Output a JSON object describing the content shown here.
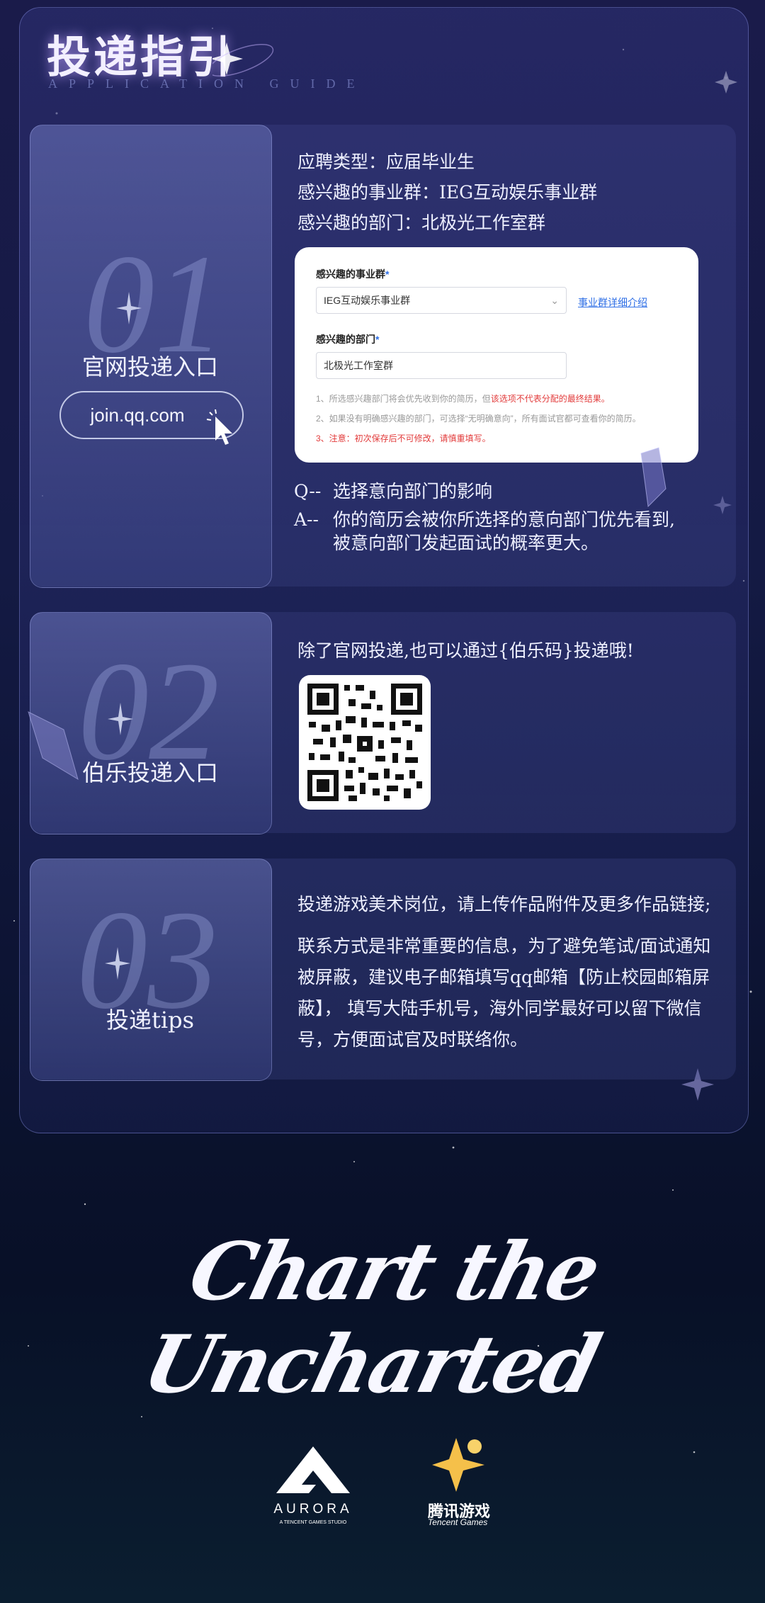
{
  "header": {
    "title": "投递指引",
    "subtitle": "APPLICATION GUIDE"
  },
  "section1": {
    "number": "01",
    "label": "官网投递入口",
    "url": "join.qq.com",
    "lines": [
      "应聘类型：应届毕业生",
      "感兴趣的事业群：IEG互动娱乐事业群",
      "感兴趣的部门：北极光工作室群"
    ],
    "form": {
      "group_label": "感兴趣的事业群",
      "group_value": "IEG互动娱乐事业群",
      "group_link": "事业群详细介绍",
      "dept_label": "感兴趣的部门",
      "dept_value": "北极光工作室群",
      "required_mark": "*",
      "note1_a": "1、所选感兴趣部门将会优先收到你的简历，但",
      "note1_b": "该选项不代表分配的最终结果。",
      "note2": "2、如果没有明确感兴趣的部门，可选择“无明确意向”，所有面试官都可查看你的简历。",
      "note3": "3、注意：初次保存后不可修改，请慎重填写。"
    },
    "qa": {
      "q_prefix": "Q--",
      "q": "选择意向部门的影响",
      "a_prefix": "A--",
      "a1": "你的简历会被你所选择的意向部门优先看到,",
      "a2": "被意向部门发起面试的概率更大。"
    }
  },
  "section2": {
    "number": "02",
    "label": "伯乐投递入口",
    "text": "除了官网投递,也可以通过{伯乐码}投递哦!"
  },
  "section3": {
    "number": "03",
    "label": "投递tips",
    "p1": "投递游戏美术岗位，请上传作品附件及更多作品链接;",
    "p2_lines": [
      "联系方式是非常重要的信息，为了避免笔试/面试通知",
      "被屏蔽，建议电子邮箱填写qq邮箱【防止校园邮箱屏",
      "蔽】， 填写大陆手机号，海外同学最好可以留下微信",
      "号，方便面试官及时联络你。"
    ]
  },
  "footer": {
    "slogan": "Chart the Uncharted",
    "aurora_name": "AURORA",
    "aurora_sub": "A TENCENT GAMES STUDIO",
    "tencent_cn": "腾讯游戏",
    "tencent_en": "Tencent Games"
  }
}
